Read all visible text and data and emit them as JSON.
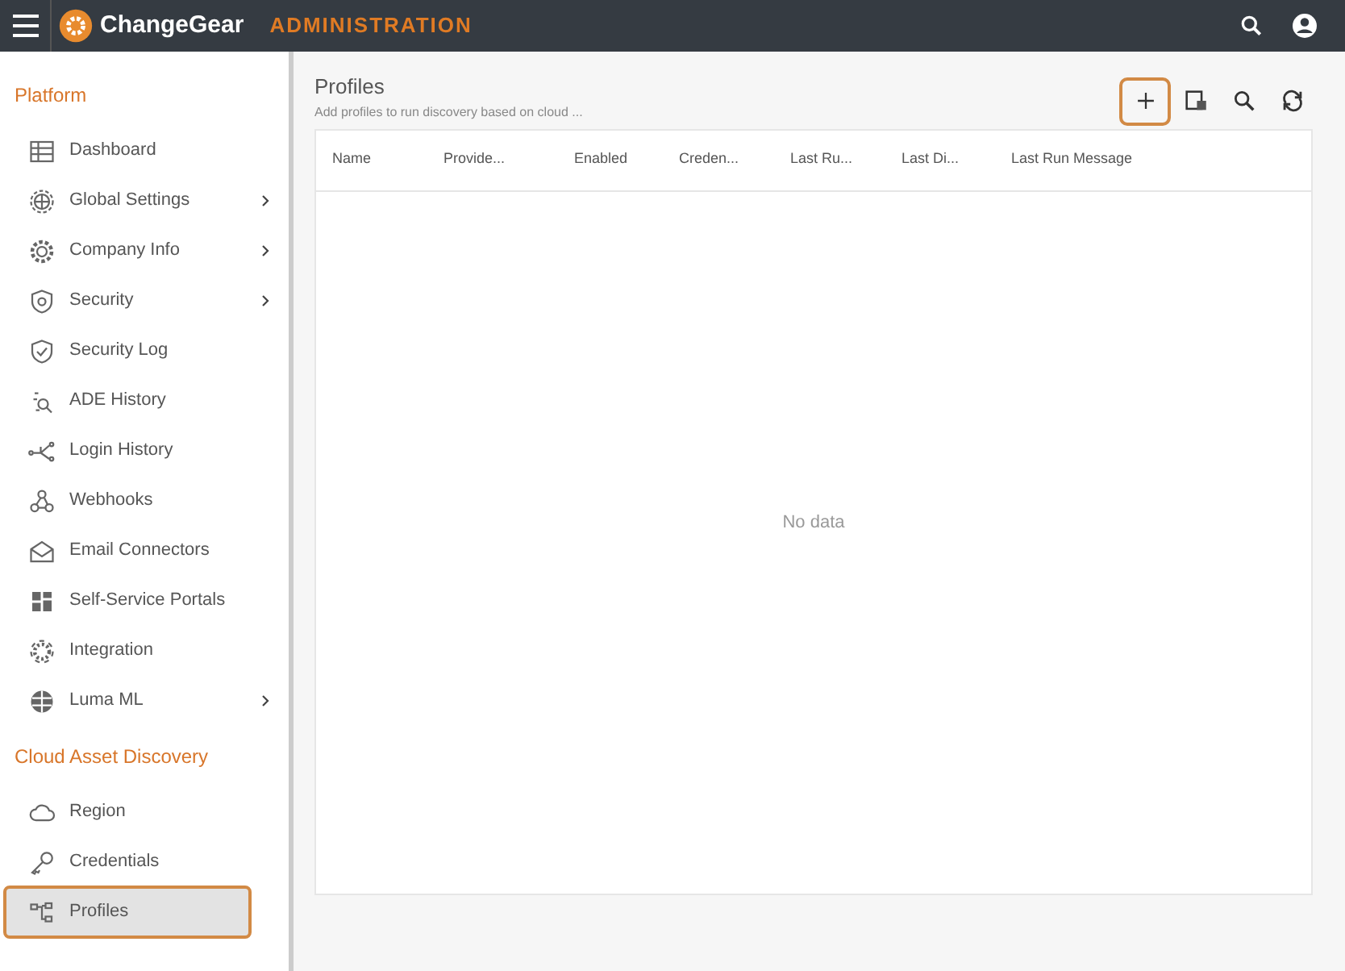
{
  "header": {
    "brand": "ChangeGear",
    "section": "ADMINISTRATION"
  },
  "sidebar": {
    "groups": [
      {
        "title": "Platform",
        "items": [
          {
            "label": "Dashboard",
            "has_submenu": false,
            "selected": false,
            "highlighted": false
          },
          {
            "label": "Global Settings",
            "has_submenu": true,
            "selected": false,
            "highlighted": false
          },
          {
            "label": "Company Info",
            "has_submenu": true,
            "selected": false,
            "highlighted": false
          },
          {
            "label": "Security",
            "has_submenu": true,
            "selected": false,
            "highlighted": false
          },
          {
            "label": "Security Log",
            "has_submenu": false,
            "selected": false,
            "highlighted": false
          },
          {
            "label": "ADE History",
            "has_submenu": false,
            "selected": false,
            "highlighted": false
          },
          {
            "label": "Login History",
            "has_submenu": false,
            "selected": false,
            "highlighted": false
          },
          {
            "label": "Webhooks",
            "has_submenu": false,
            "selected": false,
            "highlighted": false
          },
          {
            "label": "Email Connectors",
            "has_submenu": false,
            "selected": false,
            "highlighted": false
          },
          {
            "label": "Self-Service Portals",
            "has_submenu": false,
            "selected": false,
            "highlighted": false
          },
          {
            "label": "Integration",
            "has_submenu": false,
            "selected": false,
            "highlighted": false
          },
          {
            "label": "Luma ML",
            "has_submenu": true,
            "selected": false,
            "highlighted": false
          }
        ]
      },
      {
        "title": "Cloud Asset Discovery",
        "items": [
          {
            "label": "Region",
            "has_submenu": false,
            "selected": false,
            "highlighted": false
          },
          {
            "label": "Credentials",
            "has_submenu": false,
            "selected": false,
            "highlighted": false
          },
          {
            "label": "Profiles",
            "has_submenu": false,
            "selected": true,
            "highlighted": true
          }
        ]
      }
    ]
  },
  "page": {
    "title": "Profiles",
    "subtitle": "Add profiles to run discovery based on cloud ...",
    "toolbar": [
      {
        "kind": "add",
        "highlighted": true
      },
      {
        "kind": "columns",
        "highlighted": false
      },
      {
        "kind": "search",
        "highlighted": false
      },
      {
        "kind": "refresh",
        "highlighted": false
      }
    ]
  },
  "table": {
    "columns": [
      "Name",
      "Provide...",
      "Enabled",
      "Creden...",
      "Last Ru...",
      "Last Di...",
      "Last Run Message"
    ],
    "empty_text": "No data"
  }
}
